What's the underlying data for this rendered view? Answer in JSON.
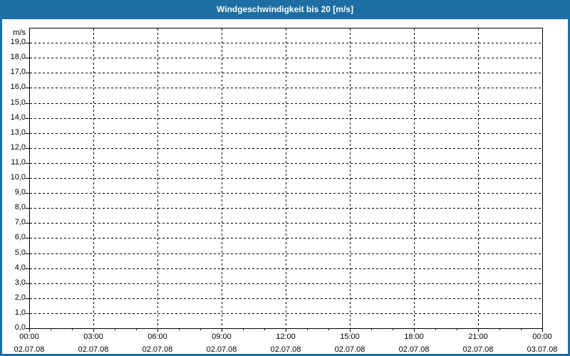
{
  "header": {
    "title": "Windgeschwindigkeit bis 20 [m/s]"
  },
  "colors": {
    "frame_blue": "#1c6ea4",
    "title_text": "#ffffff",
    "plot_background": "#ffffff",
    "axis_and_grid": "#000000",
    "label_text": "#000000"
  },
  "chart_data": {
    "type": "line",
    "title": "Windgeschwindigkeit bis 20 [m/s]",
    "series": [],
    "note": "empty plot area - no data series drawn",
    "ylabel": "m/s",
    "ylim": [
      0,
      20
    ],
    "y_tick_step": 1,
    "y_tick_labels": [
      "0,0",
      "1,0",
      "2,0",
      "3,0",
      "4,0",
      "5,0",
      "6,0",
      "7,0",
      "8,0",
      "9,0",
      "10,0",
      "11,0",
      "12,0",
      "13,0",
      "14,0",
      "15,0",
      "16,0",
      "17,0",
      "18,0",
      "19,0"
    ],
    "x_range_hours": [
      0,
      24
    ],
    "x_minor_tick_hours": 1,
    "x_major_tick_hours": 3,
    "x_ticks": [
      {
        "hour": 0,
        "time": "00:00",
        "date": "02.07.08"
      },
      {
        "hour": 3,
        "time": "03:00",
        "date": "02.07.08"
      },
      {
        "hour": 6,
        "time": "06:00",
        "date": "02.07.08"
      },
      {
        "hour": 9,
        "time": "09:00",
        "date": "02.07.08"
      },
      {
        "hour": 12,
        "time": "12:00",
        "date": "02.07.08"
      },
      {
        "hour": 15,
        "time": "15:00",
        "date": "02.07.08"
      },
      {
        "hour": 18,
        "time": "18:00",
        "date": "02.07.08"
      },
      {
        "hour": 21,
        "time": "21:00",
        "date": "02.07.08"
      },
      {
        "hour": 24,
        "time": "00:00",
        "date": "03.07.08"
      }
    ],
    "grid": {
      "horizontal_step": 1,
      "vertical_step_hours": 3,
      "style": "dashed",
      "color": "#000000"
    },
    "legend": "none"
  }
}
